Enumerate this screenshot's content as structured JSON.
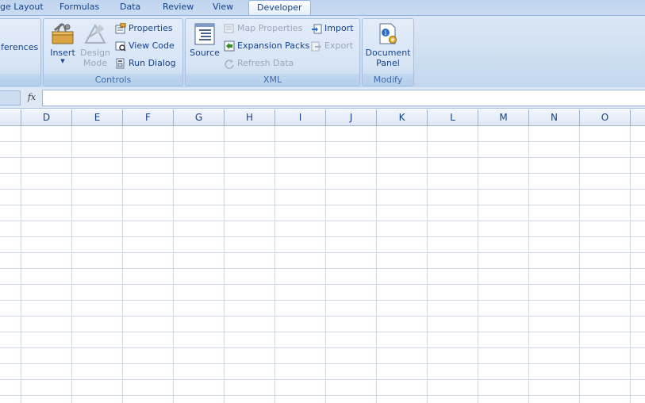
{
  "tabs": {
    "page_layout": "ge Layout",
    "formulas": "Formulas",
    "data": "Data",
    "review": "Review",
    "view": "View",
    "developer": "Developer"
  },
  "ribbon": {
    "code_group": {
      "references_label": "ferences"
    },
    "controls_group": {
      "label": "Controls",
      "insert": "Insert",
      "design_mode_1": "Design",
      "design_mode_2": "Mode",
      "properties": "Properties",
      "view_code": "View Code",
      "run_dialog": "Run Dialog"
    },
    "xml_group": {
      "label": "XML",
      "source": "Source",
      "map_properties": "Map Properties",
      "expansion_packs": "Expansion Packs",
      "refresh_data": "Refresh Data",
      "import": "Import",
      "export": "Export"
    },
    "modify_group": {
      "label": "Modify",
      "document_panel_1": "Document",
      "document_panel_2": "Panel"
    }
  },
  "formula_bar": {
    "fx": "fx",
    "value": ""
  },
  "columns": [
    "D",
    "E",
    "F",
    "G",
    "H",
    "I",
    "J",
    "K",
    "L",
    "M",
    "N",
    "O"
  ],
  "colors": {
    "accent": "#15428b",
    "ribbon_bg": "#cfdff2",
    "gridline": "#d0d7e5"
  }
}
